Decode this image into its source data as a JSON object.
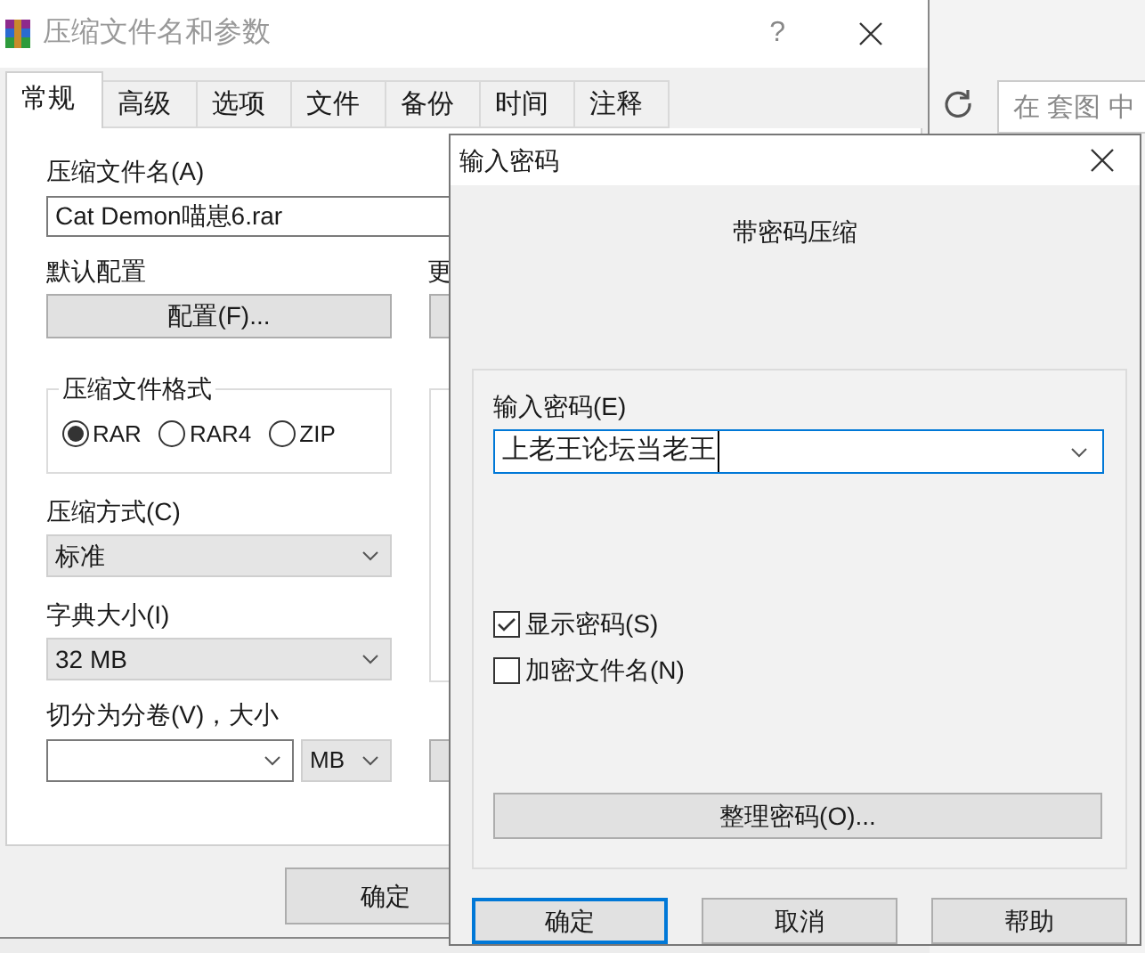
{
  "background_app": {
    "search_placeholder": "在 套图 中"
  },
  "main_dialog": {
    "title": "压缩文件名和参数",
    "help": "?",
    "tabs": [
      {
        "label": "常规",
        "selected": true
      },
      {
        "label": "高级",
        "selected": false
      },
      {
        "label": "选项",
        "selected": false
      },
      {
        "label": "文件",
        "selected": false
      },
      {
        "label": "备份",
        "selected": false
      },
      {
        "label": "时间",
        "selected": false
      },
      {
        "label": "注释",
        "selected": false
      }
    ],
    "archive_name_label": "压缩文件名(A)",
    "archive_name": "Cat Demon喵崽6.rar",
    "profile_label": "默认配置",
    "profile_button": "配置(F)...",
    "update_label": "更",
    "format_group": {
      "title": "压缩文件格式",
      "options": [
        {
          "label": "RAR",
          "selected": true
        },
        {
          "label": "RAR4",
          "selected": false
        },
        {
          "label": "ZIP",
          "selected": false
        }
      ]
    },
    "method_label": "压缩方式(C)",
    "method": "标准",
    "dictionary_label": "字典大小(I)",
    "dictionary": "32 MB",
    "split_label": "切分为分卷(V)，大小",
    "split_unit": "MB",
    "ok_button": "确定"
  },
  "password_dialog": {
    "title": "输入密码",
    "heading": "带密码压缩",
    "password_label": "输入密码(E)",
    "password": "上老王论坛当老王",
    "options": [
      {
        "label": "显示密码(S)",
        "checked": true
      },
      {
        "label": "加密文件名(N)",
        "checked": false
      }
    ],
    "organize_button": "整理密码(O)...",
    "buttons": [
      {
        "label": "确定",
        "focused": true
      },
      {
        "label": "取消",
        "focused": false
      },
      {
        "label": "帮助",
        "focused": false
      }
    ]
  }
}
